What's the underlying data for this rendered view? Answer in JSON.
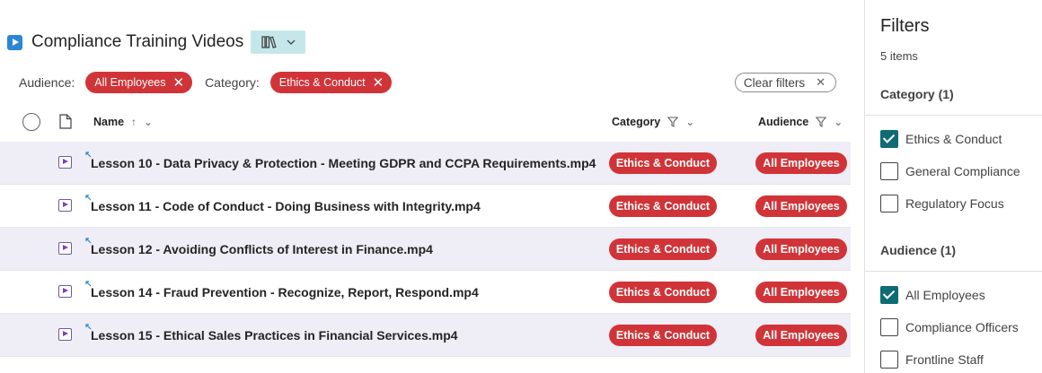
{
  "header": {
    "title": "Compliance Training Videos"
  },
  "active_filters": {
    "audience_label": "Audience:",
    "audience_value": "All Employees",
    "category_label": "Category:",
    "category_value": "Ethics & Conduct",
    "clear_label": "Clear filters"
  },
  "columns": {
    "name": "Name",
    "category": "Category",
    "audience": "Audience"
  },
  "rows": [
    {
      "name": "Lesson 10 - Data Privacy & Protection - Meeting GDPR and CCPA Requirements.mp4",
      "category": "Ethics & Conduct",
      "audience": "All Employees"
    },
    {
      "name": "Lesson 11 - Code of Conduct - Doing Business with Integrity.mp4",
      "category": "Ethics & Conduct",
      "audience": "All Employees"
    },
    {
      "name": "Lesson 12 - Avoiding Conflicts of Interest in Finance.mp4",
      "category": "Ethics & Conduct",
      "audience": "All Employees"
    },
    {
      "name": "Lesson 14 - Fraud Prevention - Recognize, Report, Respond.mp4",
      "category": "Ethics & Conduct",
      "audience": "All Employees"
    },
    {
      "name": "Lesson 15 - Ethical Sales Practices in Financial Services.mp4",
      "category": "Ethics & Conduct",
      "audience": "All Employees"
    }
  ],
  "filters_pane": {
    "title": "Filters",
    "count": "5 items",
    "category": {
      "title": "Category (1)",
      "options": [
        {
          "label": "Ethics & Conduct",
          "checked": true
        },
        {
          "label": "General Compliance",
          "checked": false
        },
        {
          "label": "Regulatory Focus",
          "checked": false
        }
      ]
    },
    "audience": {
      "title": "Audience (1)",
      "options": [
        {
          "label": "All Employees",
          "checked": true
        },
        {
          "label": "Compliance Officers",
          "checked": false
        },
        {
          "label": "Frontline Staff",
          "checked": false
        }
      ]
    }
  },
  "colors": {
    "tag_red": "#d13438",
    "checkbox_teal": "#0f6c74",
    "view_button": "#c5e7ea",
    "row_shade": "#efedf5"
  }
}
